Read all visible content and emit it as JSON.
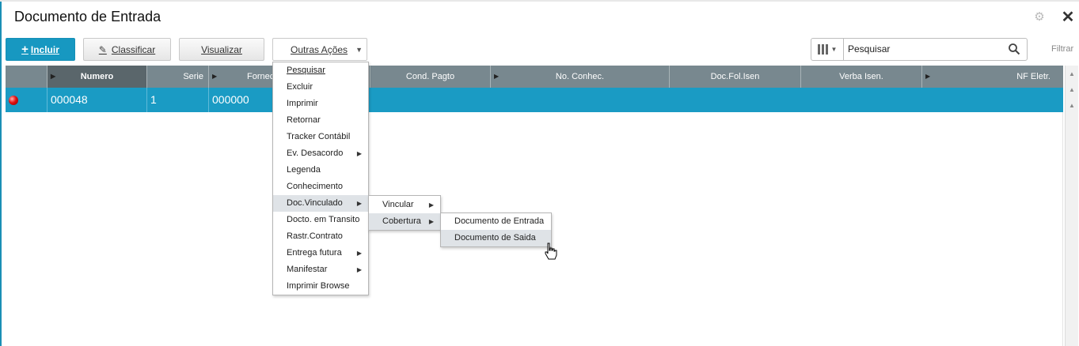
{
  "window": {
    "title": "Documento de Entrada"
  },
  "toolbar": {
    "incluir_label": "Incluir",
    "classificar_label": "Classificar",
    "visualizar_label": "Visualizar",
    "outras_acoes_label": "Outras Ações"
  },
  "search": {
    "placeholder": "Pesquisar",
    "value": "Pesquisar",
    "filtrar_label": "Filtrar"
  },
  "grid": {
    "headers": [
      "Numero",
      "Serie",
      "Fornec",
      "Cond. Pagto",
      "No. Conhec.",
      "Doc.Fol.Isen",
      "Verba Isen.",
      "NF Eletr."
    ],
    "row": {
      "status": "red",
      "numero": "000048",
      "serie": "1",
      "fornecedor": "000000"
    }
  },
  "menu": {
    "items": [
      "Pesquisar",
      "Excluir",
      "Imprimir",
      "Retornar",
      "Tracker Contábil",
      "Ev. Desacordo",
      "Legenda",
      "Conhecimento",
      "Doc.Vinculado",
      "Docto. em Transito",
      "Rastr.Contrato",
      "Entrega futura",
      "Manifestar",
      "Imprimir Browse"
    ],
    "highlighted": "Doc.Vinculado",
    "submenu": {
      "items": [
        "Vincular",
        "Cobertura"
      ],
      "highlighted": "Cobertura"
    },
    "submenu2": {
      "items": [
        "Documento de Entrada",
        "Documento de Saida"
      ],
      "highlighted": "Documento de Saida"
    }
  },
  "colors": {
    "accent": "#1798c1",
    "header_bg": "#78888f",
    "row_selected": "#1a9bc4",
    "status_red": "#e01010"
  },
  "icons": [
    "gear-icon",
    "close-icon",
    "plus-icon",
    "pencil-icon",
    "caret-down-icon",
    "columns-icon",
    "search-icon",
    "legend-status-icon",
    "chevron-right-icon",
    "hand-cursor-icon"
  ]
}
